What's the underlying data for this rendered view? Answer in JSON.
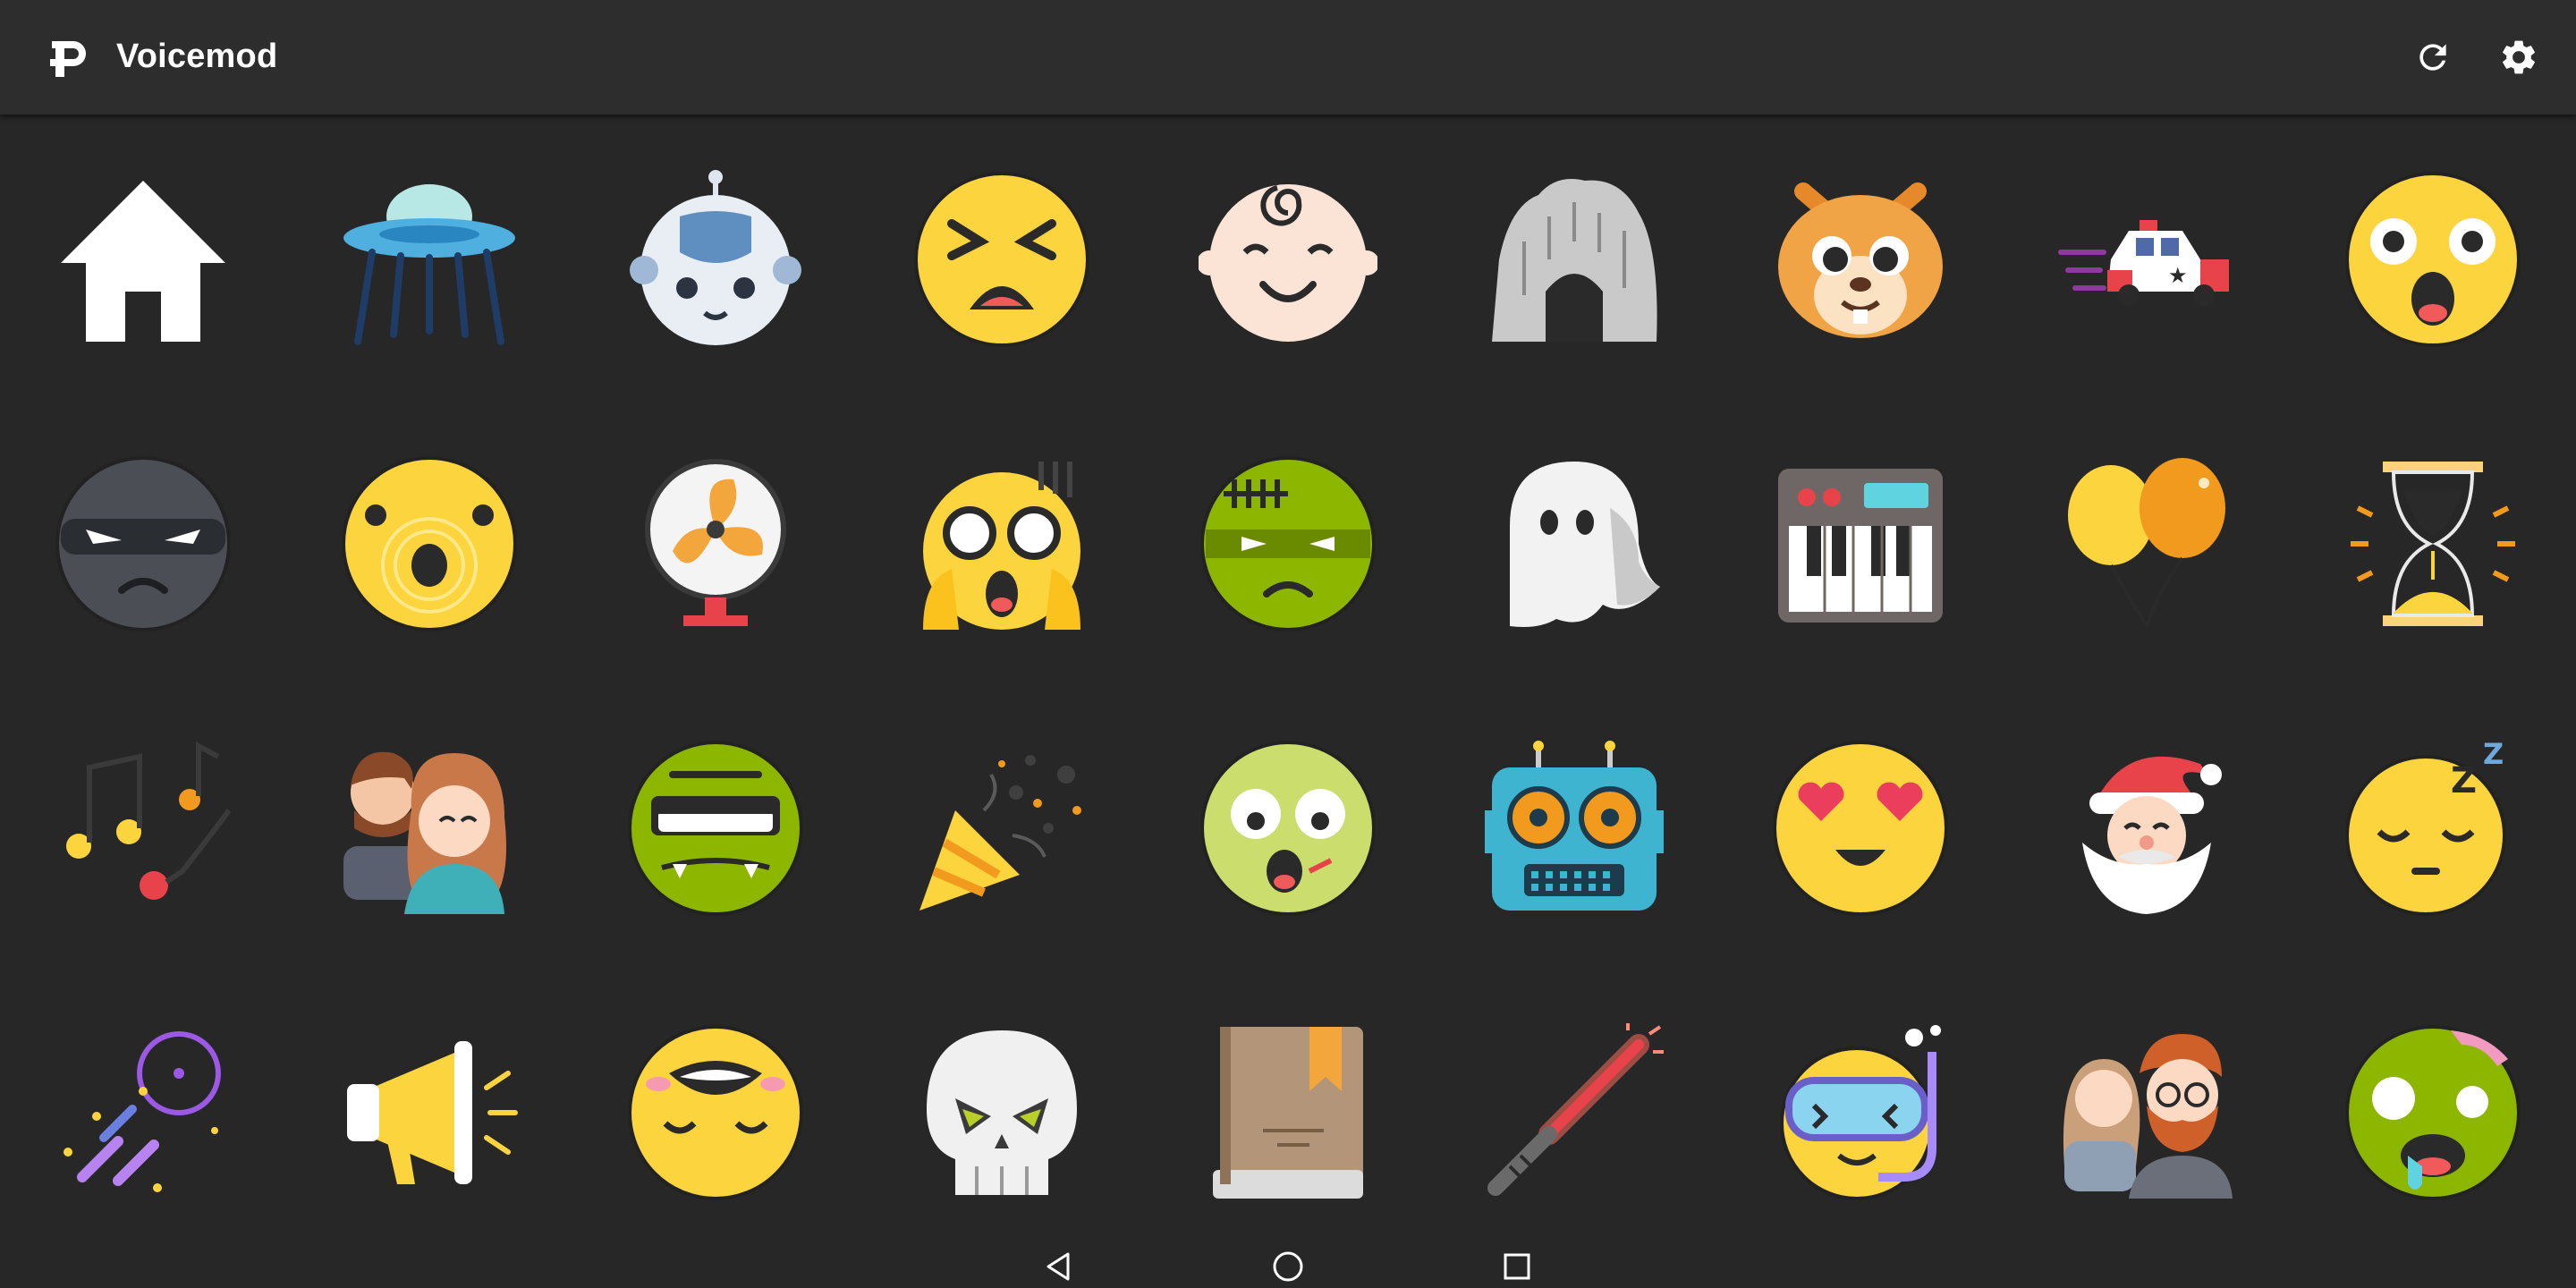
{
  "app": {
    "title": "Voicemod"
  },
  "toolbar": {
    "refresh_icon": "refresh-icon",
    "settings_icon": "gear-icon"
  },
  "voices": [
    {
      "icon": "home"
    },
    {
      "icon": "ufo"
    },
    {
      "icon": "robot-head"
    },
    {
      "icon": "pained-face"
    },
    {
      "icon": "baby-face"
    },
    {
      "icon": "cave"
    },
    {
      "icon": "chipmunk"
    },
    {
      "icon": "police-car"
    },
    {
      "icon": "shocked-face"
    },
    {
      "icon": "masked-face"
    },
    {
      "icon": "echo-face"
    },
    {
      "icon": "fan"
    },
    {
      "icon": "scream-face"
    },
    {
      "icon": "frankenstein-face"
    },
    {
      "icon": "ghost"
    },
    {
      "icon": "synthesizer"
    },
    {
      "icon": "balloons"
    },
    {
      "icon": "hourglass"
    },
    {
      "icon": "music-notes"
    },
    {
      "icon": "man-woman"
    },
    {
      "icon": "goblin-face"
    },
    {
      "icon": "party-popper"
    },
    {
      "icon": "sick-face"
    },
    {
      "icon": "speaker-robot"
    },
    {
      "icon": "heart-eyes-face"
    },
    {
      "icon": "santa"
    },
    {
      "icon": "sleeping-face"
    },
    {
      "icon": "magic-sparkles"
    },
    {
      "icon": "megaphone"
    },
    {
      "icon": "laughing-face"
    },
    {
      "icon": "skull"
    },
    {
      "icon": "book"
    },
    {
      "icon": "lightsaber"
    },
    {
      "icon": "snorkel-face"
    },
    {
      "icon": "woman-man"
    },
    {
      "icon": "zombie-face"
    }
  ],
  "nav": {
    "back_icon": "back-triangle-icon",
    "home_icon": "home-circle-icon",
    "recents_icon": "recents-square-icon"
  },
  "colors": {
    "appbar": "#2d2d2d",
    "background": "#272727",
    "yellow": "#fcd43d",
    "green": "#8db600"
  }
}
